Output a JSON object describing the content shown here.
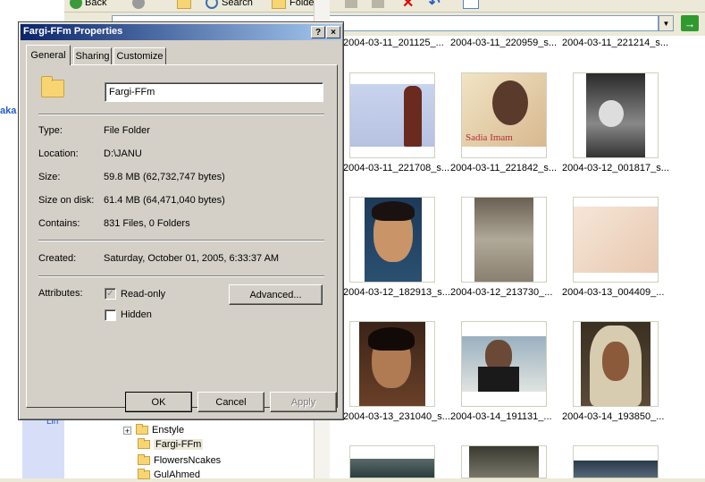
{
  "explorer": {
    "toolbar": {
      "back_label": "Back",
      "search_label": "Search",
      "folders_label": "Folders"
    },
    "left_link_text": "aka",
    "tasks_label": "Lin",
    "tree": [
      {
        "label": "Enstyle",
        "expandable": true,
        "selected": false
      },
      {
        "label": "Fargi-FFm",
        "expandable": false,
        "selected": true
      },
      {
        "label": "FlowersNcakes",
        "expandable": false,
        "selected": false
      },
      {
        "label": "GulAhmed",
        "expandable": false,
        "selected": false
      }
    ],
    "thumbnails": [
      {
        "caption": "2004-03-11_201125_..."
      },
      {
        "caption": "2004-03-11_220959_s..."
      },
      {
        "caption": "2004-03-11_221214_s..."
      },
      {
        "caption": "2004-03-11_221708_s..."
      },
      {
        "caption": "2004-03-11_221842_s...",
        "image_text": "Sadia Imam"
      },
      {
        "caption": "2004-03-12_001817_s..."
      },
      {
        "caption": "2004-03-12_182913_s..."
      },
      {
        "caption": "2004-03-12_213730_..."
      },
      {
        "caption": "2004-03-13_004409_..."
      },
      {
        "caption": "2004-03-13_231040_s..."
      },
      {
        "caption": "2004-03-14_191131_..."
      },
      {
        "caption": "2004-03-14_193850_..."
      }
    ]
  },
  "dialog": {
    "title": "Fargi-FFm Properties",
    "help_glyph": "?",
    "close_glyph": "×",
    "tabs": [
      {
        "label": "General",
        "active": true
      },
      {
        "label": "Sharing",
        "active": false
      },
      {
        "label": "Customize",
        "active": false
      }
    ],
    "name_value": "Fargi-FFm",
    "fields": {
      "type": {
        "label": "Type:",
        "value": "File Folder"
      },
      "location": {
        "label": "Location:",
        "value": "D:\\JANU"
      },
      "size": {
        "label": "Size:",
        "value": "59.8 MB (62,732,747 bytes)"
      },
      "size_on_disk": {
        "label": "Size on disk:",
        "value": "61.4 MB (64,471,040 bytes)"
      },
      "contains": {
        "label": "Contains:",
        "value": "831 Files, 0 Folders"
      },
      "created": {
        "label": "Created:",
        "value": "Saturday, October 01, 2005, 6:33:37 AM"
      }
    },
    "attributes": {
      "label": "Attributes:",
      "readonly_label": "Read-only",
      "readonly_checked": true,
      "hidden_label": "Hidden",
      "hidden_checked": false,
      "advanced_label": "Advanced..."
    },
    "buttons": {
      "ok": "OK",
      "cancel": "Cancel",
      "apply": "Apply"
    }
  },
  "colors": {
    "title_gradient_start": "#0a246a",
    "title_gradient_end": "#a6caf0",
    "dialog_face": "#d4d0c8",
    "link_blue": "#215dc6"
  }
}
